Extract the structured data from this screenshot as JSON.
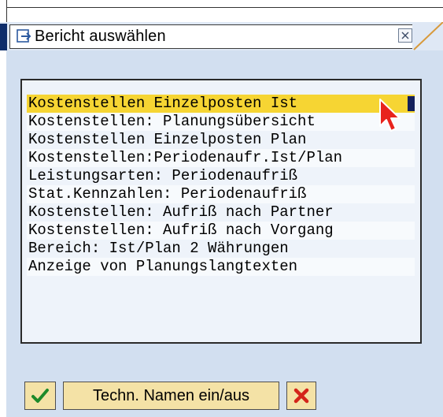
{
  "dialog": {
    "title": "Bericht auswählen"
  },
  "list": {
    "items": [
      "Kostenstellen Einzelposten Ist",
      "Kostenstellen: Planungsübersicht",
      "Kostenstellen Einzelposten Plan",
      "Kostenstellen:Periodenaufr.Ist/Plan",
      "Leistungsarten: Periodenaufriß",
      "Stat.Kennzahlen: Periodenaufriß",
      "Kostenstellen: Aufriß nach Partner",
      "Kostenstellen: Aufriß nach Vorgang",
      "Bereich: Ist/Plan 2 Währungen",
      "Anzeige von Planungslangtexten"
    ],
    "selected_index": 0
  },
  "footer": {
    "techn_label": "Techn. Namen ein/aus"
  },
  "colors": {
    "selection": "#f6d533",
    "background": "#d2dff0",
    "button": "#f4e2a6"
  },
  "icons": {
    "title": "report-select-icon",
    "close": "close-icon",
    "confirm": "checkmark-icon",
    "cancel": "cancel-icon",
    "pointer": "mouse-pointer-icon"
  }
}
